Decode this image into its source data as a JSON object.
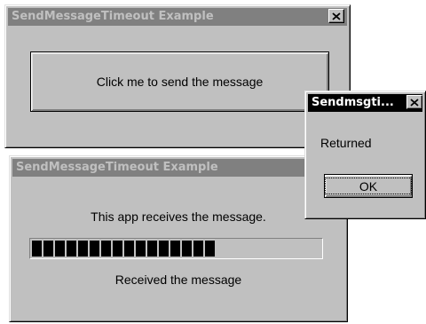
{
  "window1": {
    "title": "SendMessageTimeout Example",
    "button_label": "Click me to send the message"
  },
  "window2": {
    "title": "SendMessageTimeout Example",
    "info_text": "This app receives the message.",
    "progress_segments": 16,
    "progress_fraction": 0.62,
    "status_text": "Received the message"
  },
  "dialog": {
    "title": "Sendmsgti...",
    "message": "Returned",
    "ok_label": "OK"
  },
  "icons": {
    "close": "close-icon"
  },
  "colors": {
    "face": "#c0c0c0",
    "title_inactive": "#808080",
    "title_active": "#000000",
    "progress": "#000000"
  }
}
